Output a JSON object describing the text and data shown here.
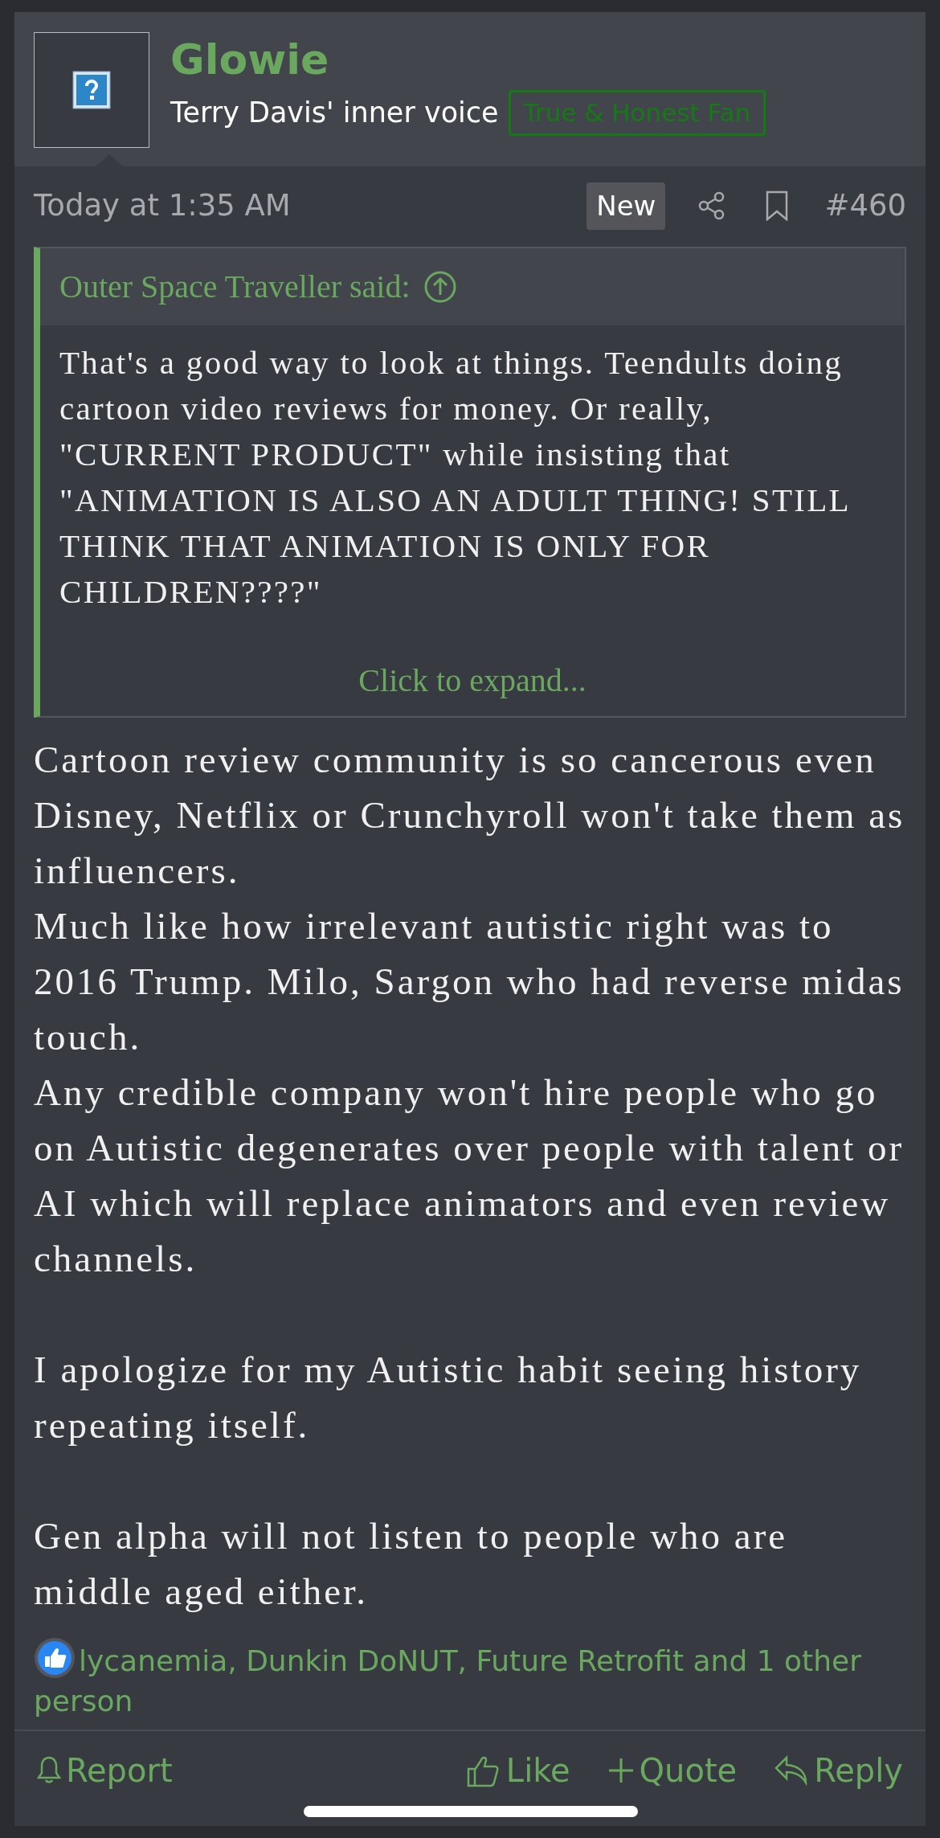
{
  "post": {
    "author": "Glowie",
    "user_title": "Terry Davis' inner voice",
    "user_banner": "True & Honest Fan",
    "date": "Today at 1:35 AM",
    "new_badge": "New",
    "number": "#460"
  },
  "quote": {
    "attribution": "Outer Space Traveller said:",
    "text": "That's a good way to look at things. Teendults doing cartoon video reviews for money. Or really, \"CURRENT PRODUCT\" while insisting that \"ANIMATION IS ALSO AN ADULT THING! STILL THINK THAT ANIMATION IS ONLY FOR CHILDREN????\"",
    "expand": "Click to expand..."
  },
  "body": [
    "Cartoon review community is so cancerous even Disney, Netflix or Crunchyroll won't take them as influencers.\nMuch like how irrelevant autistic right was to 2016 Trump. Milo, Sargon who had reverse midas touch.\nAny credible company won't hire people who go on Autistic degenerates over people with talent or AI which will replace animators and even review channels.",
    "I apologize for my Autistic habit seeing history repeating itself.",
    "Gen alpha will not listen to people who are middle aged either."
  ],
  "reactions": {
    "text": "lycanemia, Dunkin DoNUT, Future Retrofit and 1 other person"
  },
  "actions": [
    {
      "kind": "report",
      "label": "Report"
    },
    {
      "kind": "like",
      "label": "Like"
    },
    {
      "kind": "quote",
      "label": "Quote"
    },
    {
      "kind": "reply",
      "label": "Reply"
    }
  ]
}
